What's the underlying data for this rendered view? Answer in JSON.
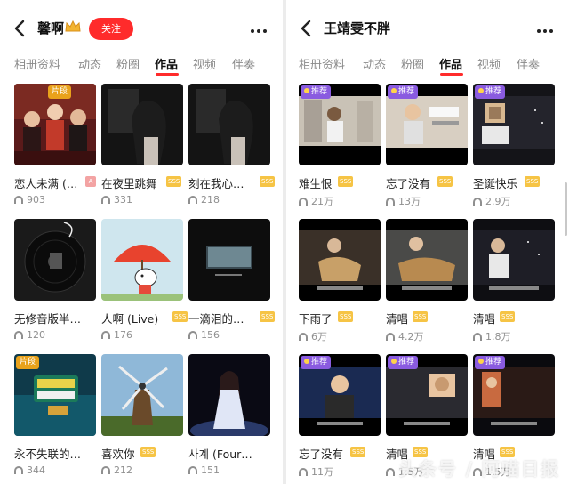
{
  "left": {
    "title": "馨啊",
    "follow_label": "关注",
    "tabs": [
      "相册资料",
      "动态",
      "粉圈",
      "作品",
      "视频",
      "伴奏"
    ],
    "active_tab": "作品",
    "items": [
      {
        "title": "恋人未满 (…",
        "plays": "903",
        "badge": "A",
        "tag": "片段",
        "thumb": "group-photo"
      },
      {
        "title": "在夜里跳舞",
        "plays": "331",
        "badge": "SSS",
        "tag": "",
        "thumb": "dark-portrait"
      },
      {
        "title": "刻在我心…",
        "plays": "218",
        "badge": "SSS",
        "tag": "",
        "thumb": "dark-portrait"
      },
      {
        "title": "无修音版半…",
        "plays": "120",
        "badge": "",
        "tag": "",
        "thumb": "vinyl"
      },
      {
        "title": "人啊 (Live)",
        "plays": "176",
        "badge": "SSS",
        "tag": "",
        "thumb": "cartoon-umbrella"
      },
      {
        "title": "一滴泪的…",
        "plays": "156",
        "badge": "SSS",
        "tag": "",
        "thumb": "dark-window"
      },
      {
        "title": "永不失联的…",
        "plays": "344",
        "badge": "",
        "tag": "片段",
        "thumb": "tv-show"
      },
      {
        "title": "喜欢你",
        "plays": "212",
        "badge": "SSS",
        "tag": "",
        "thumb": "windmill"
      },
      {
        "title": "사계 (Four…",
        "plays": "151",
        "badge": "",
        "tag": "",
        "thumb": "stage-singer"
      }
    ]
  },
  "right": {
    "title": "王靖雯不胖",
    "tabs": [
      "相册资料",
      "动态",
      "粉圈",
      "作品",
      "视频",
      "伴奏"
    ],
    "active_tab": "作品",
    "items": [
      {
        "title": "难生恨",
        "plays": "21万",
        "badge": "SSS",
        "tag": "推荐",
        "thumb": "room-selfie"
      },
      {
        "title": "忘了没有",
        "plays": "13万",
        "badge": "SSS",
        "tag": "推荐",
        "thumb": "room-selfie"
      },
      {
        "title": "圣诞快乐",
        "plays": "2.9万",
        "badge": "SSS",
        "tag": "推荐",
        "thumb": "night-selfie"
      },
      {
        "title": "下雨了",
        "plays": "6万",
        "badge": "SSS",
        "tag": "",
        "thumb": "guitar"
      },
      {
        "title": "清唱",
        "plays": "4.2万",
        "badge": "SSS",
        "tag": "",
        "thumb": "guitar"
      },
      {
        "title": "清唱",
        "plays": "1.8万",
        "badge": "SSS",
        "tag": "",
        "thumb": "night-selfie"
      },
      {
        "title": "忘了没有",
        "plays": "11万",
        "badge": "SSS",
        "tag": "推荐",
        "thumb": "room-selfie"
      },
      {
        "title": "清唱",
        "plays": "1.5万",
        "badge": "SSS",
        "tag": "推荐",
        "thumb": "room-selfie"
      },
      {
        "title": "清唱",
        "plays": "1.5万",
        "badge": "SSS",
        "tag": "推荐",
        "thumb": "night-selfie"
      }
    ]
  },
  "watermark": "头条号 / 阿喵日报",
  "colors": {
    "accent": "#ff2b2b",
    "sss_badge": "#f6c445",
    "rec_tag": "#8a5be0",
    "clip_tag": "#e9a21b"
  }
}
